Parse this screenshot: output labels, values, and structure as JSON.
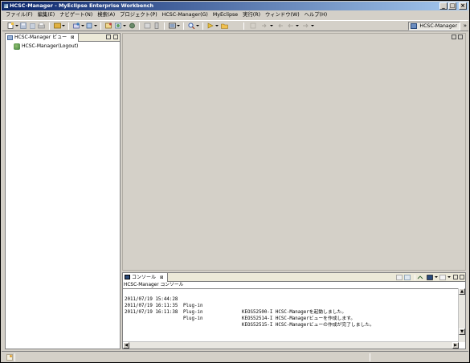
{
  "window": {
    "title": "HCSC-Manager - MyEclipse Enterprise Workbench",
    "minimize": "_",
    "maximize": "□",
    "close": "×"
  },
  "menu": [
    {
      "label": "ファイル(F)"
    },
    {
      "label": "編集(E)"
    },
    {
      "label": "ナビゲート(N)"
    },
    {
      "label": "検索(A)"
    },
    {
      "label": "プロジェクト(P)"
    },
    {
      "label": "HCSC-Manager(G)"
    },
    {
      "label": "MyEclipse"
    },
    {
      "label": "実行(R)"
    },
    {
      "label": "ウィンドウ(W)"
    },
    {
      "label": "ヘルプ(H)"
    }
  ],
  "toolbar": {
    "perspective_label": "HCSC-Manager",
    "overflow": "»"
  },
  "left_view": {
    "tab_label": "HCSC-Manager ビュー",
    "tab_close": "⊠",
    "tree_item": "HCSC-Manager(Logout)"
  },
  "console": {
    "tab_label": "コンソール",
    "tab_close": "⊠",
    "header": "HCSC-Manager コンソール",
    "lines": [
      {
        "time": "2011/07/19 15:44:28",
        "source": "Plug-in",
        "message": "KEOS52500-I HCSC-Managerを起動しました。"
      },
      {
        "time": "2011/07/19 16:11:35",
        "source": "Plug-in",
        "message": "KEOS52514-I HCSC-Managerビューを作成します。"
      },
      {
        "time": "2011/07/19 16:11:38",
        "source": "Plug-in",
        "message": "KEOS52515-I HCSC-Managerビューの作成が完了しました。"
      }
    ]
  },
  "icons": {
    "app": "app-icon",
    "perspective": "perspective-icon",
    "tree": "plugin-tree-icon",
    "console": "console-icon"
  },
  "colors": {
    "titlebar_start": "#0a246a",
    "titlebar_end": "#a6caf0",
    "chrome": "#d4d0c8"
  }
}
